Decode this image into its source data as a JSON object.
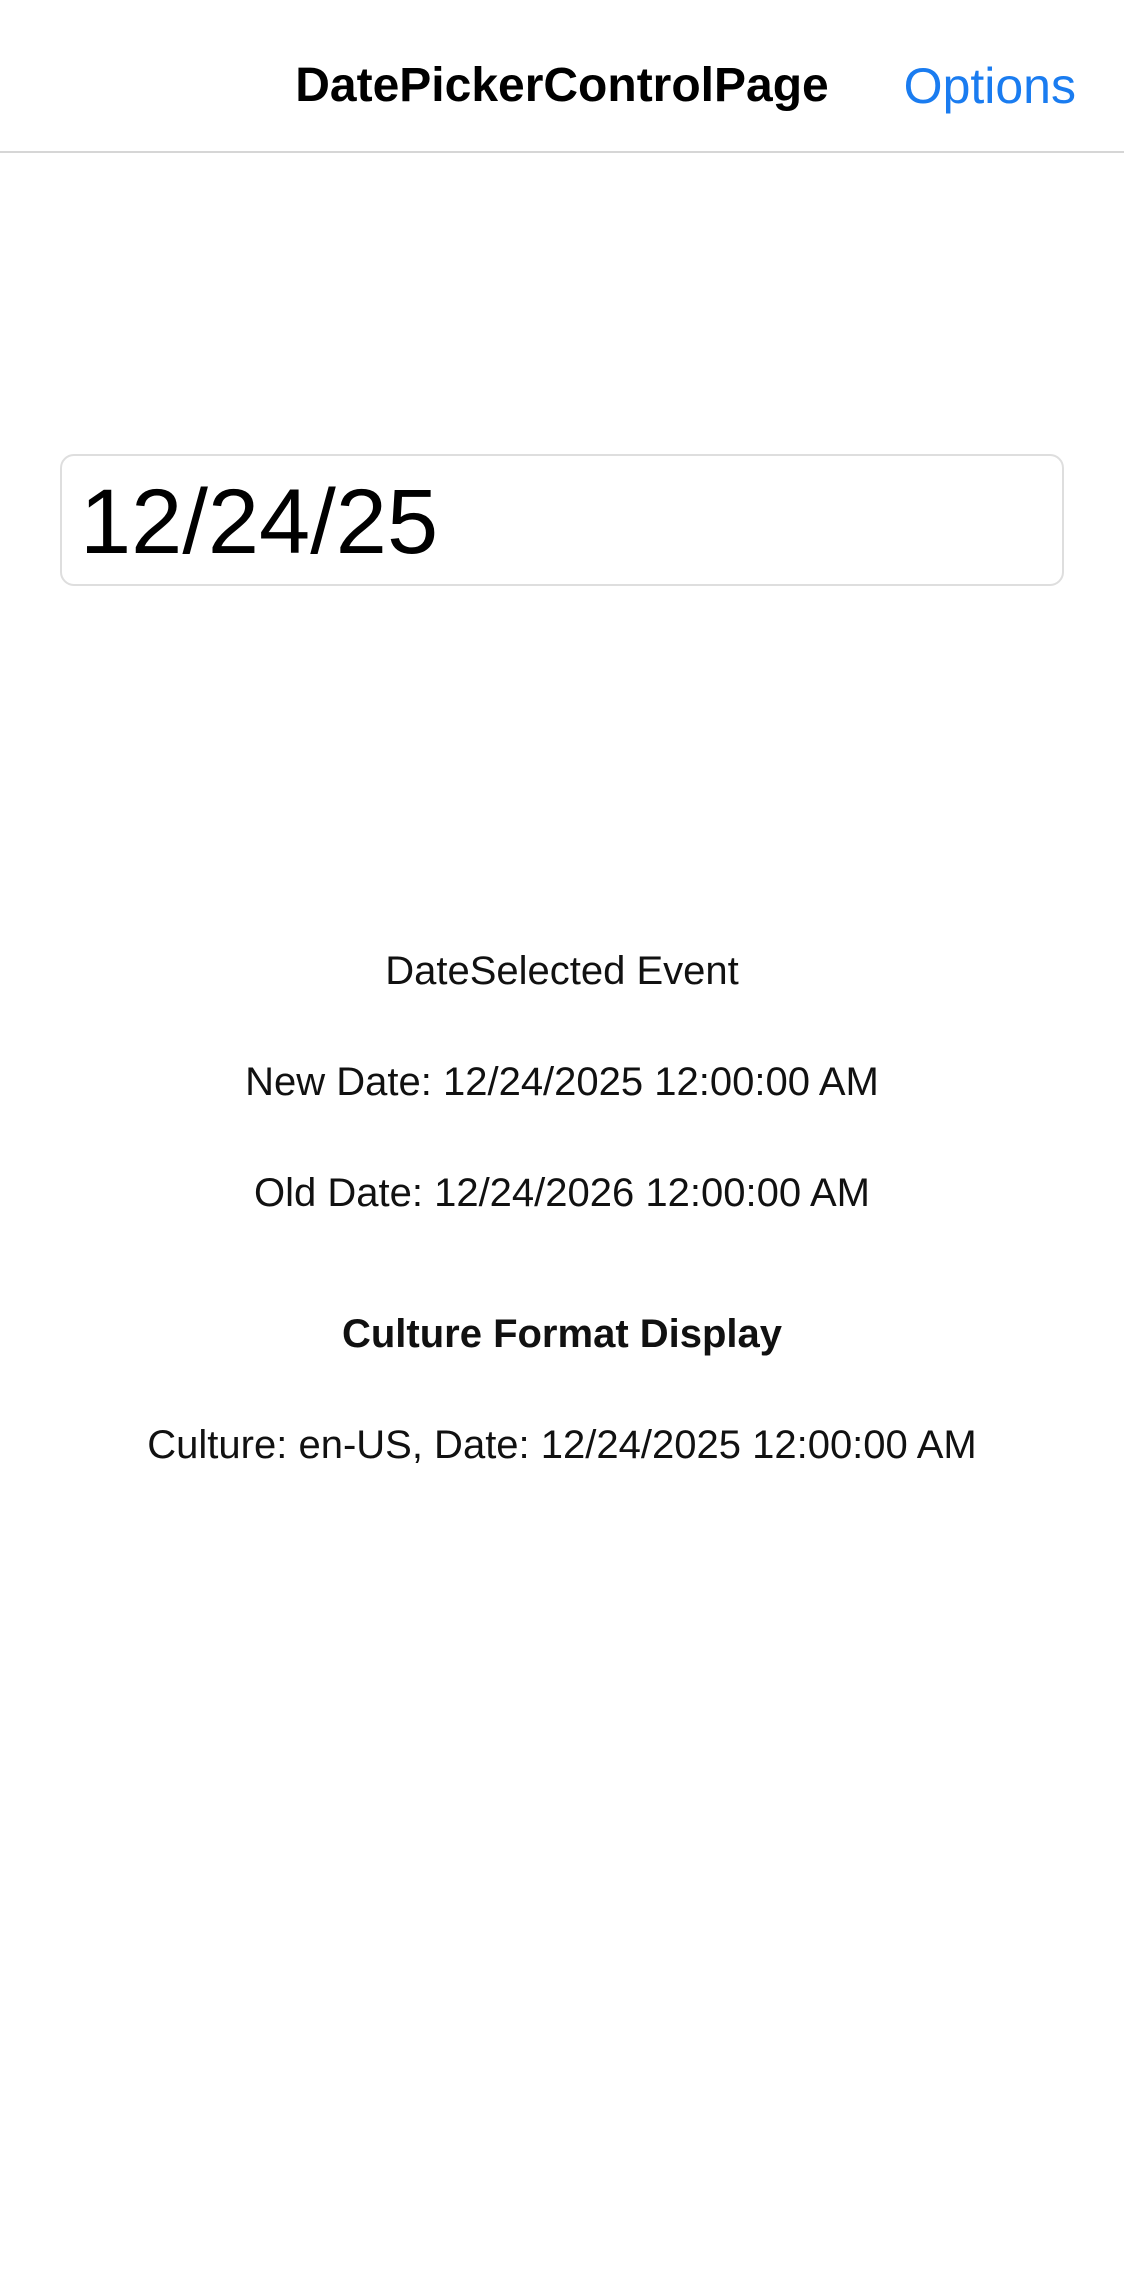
{
  "navbar": {
    "title": "DatePickerControlPage",
    "options_label": "Options",
    "accent_color": "#1a7cf0"
  },
  "date_picker": {
    "value": "12/24/25"
  },
  "events": {
    "heading": "DateSelected Event",
    "new_date": "New Date: 12/24/2025 12:00:00 AM",
    "old_date": "Old Date: 12/24/2026 12:00:00 AM"
  },
  "culture": {
    "heading": "Culture Format Display",
    "display": "Culture: en-US, Date: 12/24/2025 12:00:00 AM"
  }
}
